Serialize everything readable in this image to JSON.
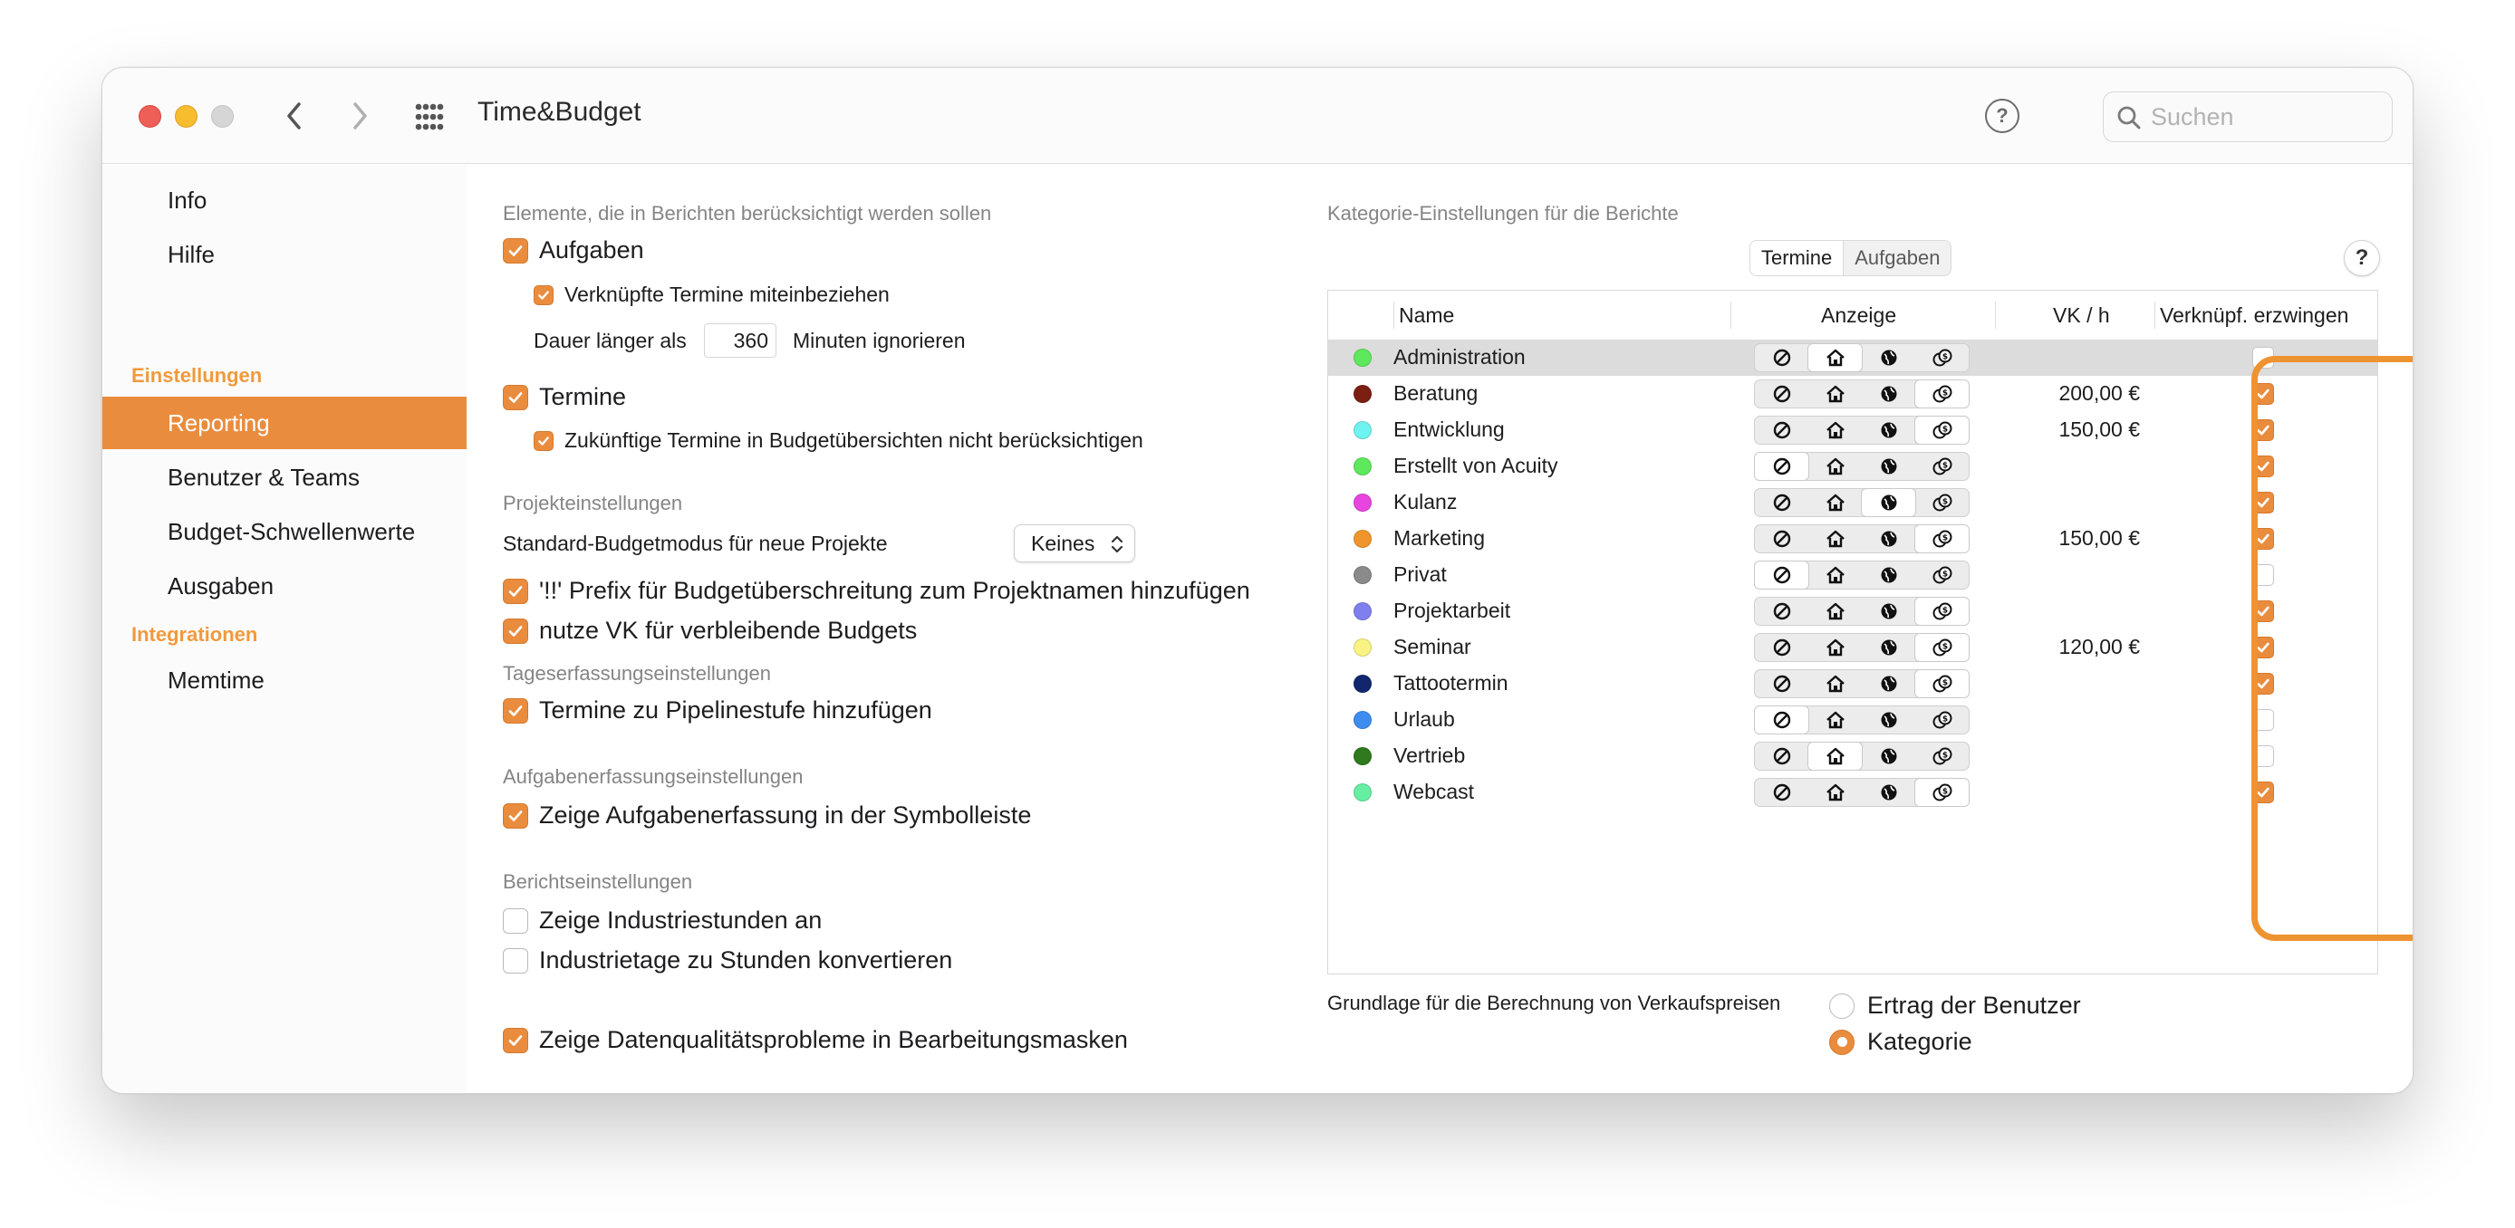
{
  "window": {
    "title": "Time&Budget",
    "search_placeholder": "Suchen"
  },
  "sidebar": {
    "items_top": [
      {
        "label": "Info"
      },
      {
        "label": "Hilfe"
      }
    ],
    "section_settings": "Einstellungen",
    "settings_items": [
      {
        "label": "Reporting",
        "active": true
      },
      {
        "label": "Benutzer & Teams"
      },
      {
        "label": "Budget-Schwellenwerte"
      },
      {
        "label": "Ausgaben"
      }
    ],
    "section_integrations": "Integrationen",
    "integrations_items": [
      {
        "label": "Memtime"
      }
    ]
  },
  "left": {
    "elements_header": "Elemente, die in Berichten berücksichtigt werden sollen",
    "tasks": {
      "label": "Aufgaben",
      "checked": true
    },
    "linked_events": {
      "label": "Verknüpfte Termine miteinbeziehen",
      "checked": true
    },
    "duration_prefix": "Dauer länger als",
    "duration_value": "360",
    "duration_suffix": "Minuten ignorieren",
    "events": {
      "label": "Termine",
      "checked": true
    },
    "future_events": {
      "label": "Zukünftige Termine in Budgetübersichten nicht berücksichtigen",
      "checked": true
    },
    "project_header": "Projekteinstellungen",
    "budget_mode_label": "Standard-Budgetmodus für neue Projekte",
    "budget_mode_value": "Keines",
    "prefix_option": {
      "label": "'!!' Prefix für Budgetüberschreitung zum Projektnamen hinzufügen",
      "checked": true
    },
    "vk_option": {
      "label": "nutze VK für verbleibende Budgets",
      "checked": true
    },
    "day_header": "Tageserfassungseinstellungen",
    "pipeline_option": {
      "label": "Termine zu Pipelinestufe hinzufügen",
      "checked": true
    },
    "task_capture_header": "Aufgabenerfassungseinstellungen",
    "toolbar_option": {
      "label": "Zeige Aufgabenerfassung in der Symbolleiste",
      "checked": true
    },
    "report_header": "Berichtseinstellungen",
    "industry_hours": {
      "label": "Zeige Industriestunden an",
      "checked": false
    },
    "industry_days": {
      "label": "Industrietage zu Stunden konvertieren",
      "checked": false
    },
    "data_quality": {
      "label": "Zeige Datenqualitätsprobleme in Bearbeitungsmasken",
      "checked": true
    }
  },
  "right": {
    "header": "Kategorie-Einstellungen für die Berichte",
    "segment": [
      "Termine",
      "Aufgaben"
    ],
    "help_label": "?",
    "columns": {
      "name": "Name",
      "display": "Anzeige",
      "vk": "VK / h",
      "enforce": "Verknüpf. erzwingen"
    },
    "rows": [
      {
        "name": "Administration",
        "color": "#5ee85c",
        "display_selected": 1,
        "vk": "",
        "enforce": false,
        "selected": true
      },
      {
        "name": "Beratung",
        "color": "#7a1f12",
        "display_selected": 3,
        "vk": "200,00 €",
        "enforce": true
      },
      {
        "name": "Entwicklung",
        "color": "#6ff3f0",
        "display_selected": 3,
        "vk": "150,00 €",
        "enforce": true
      },
      {
        "name": "Erstellt von Acuity",
        "color": "#5ee85c",
        "display_selected": 0,
        "vk": "",
        "enforce": true
      },
      {
        "name": "Kulanz",
        "color": "#e845e0",
        "display_selected": 2,
        "vk": "",
        "enforce": true
      },
      {
        "name": "Marketing",
        "color": "#f0952c",
        "display_selected": 3,
        "vk": "150,00 €",
        "enforce": true
      },
      {
        "name": "Privat",
        "color": "#8a8a8a",
        "display_selected": 0,
        "vk": "",
        "enforce": false
      },
      {
        "name": "Projektarbeit",
        "color": "#7f7ff0",
        "display_selected": 3,
        "vk": "",
        "enforce": true
      },
      {
        "name": "Seminar",
        "color": "#f8f383",
        "display_selected": 3,
        "vk": "120,00 €",
        "enforce": true
      },
      {
        "name": "Tattootermin",
        "color": "#12266e",
        "display_selected": 3,
        "vk": "",
        "enforce": true
      },
      {
        "name": "Urlaub",
        "color": "#3f8cf0",
        "display_selected": 0,
        "vk": "",
        "enforce": false
      },
      {
        "name": "Vertrieb",
        "color": "#2e7a1c",
        "display_selected": 1,
        "vk": "",
        "enforce": false
      },
      {
        "name": "Webcast",
        "color": "#66eea2",
        "display_selected": 3,
        "vk": "",
        "enforce": true
      }
    ],
    "display_icons": [
      "hidden-icon",
      "home-icon",
      "globe-icon",
      "money-icon"
    ],
    "basis_label": "Grundlage für die Berechnung von Verkaufspreisen",
    "basis_options": [
      {
        "label": "Ertrag der Benutzer",
        "checked": false
      },
      {
        "label": "Kategorie",
        "checked": true
      }
    ],
    "accent_color": "#ea8c3e",
    "highlight_color": "#ee9332"
  }
}
